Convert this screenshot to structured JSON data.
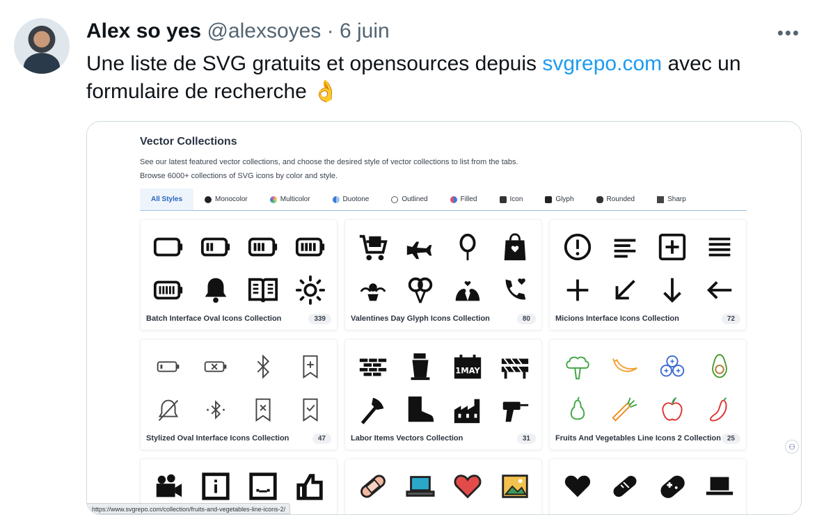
{
  "tweet": {
    "author_name": "Alex so yes",
    "handle": "@alexsoyes",
    "separator": "·",
    "date": "6 juin",
    "more_label": "•••",
    "text_before": "Une liste de SVG gratuits et opensources depuis ",
    "link_text": "svgrepo.com",
    "text_after": " avec un formulaire de recherche ",
    "emoji": "👌"
  },
  "page": {
    "title": "Vector Collections",
    "desc_line1": "See our latest featured vector collections, and choose the desired style of vector collections to list from the tabs.",
    "desc_line2": "Browse 6000+ collections of SVG icons by color and style."
  },
  "tabs": [
    {
      "label": "All Styles",
      "color": ""
    },
    {
      "label": "Monocolor",
      "color": "#222222"
    },
    {
      "label": "Multicolor",
      "color": "#e86aa0"
    },
    {
      "label": "Duotone",
      "color": "#3b7bd5"
    },
    {
      "label": "Outlined",
      "color": "#777777"
    },
    {
      "label": "Filled",
      "color": "#d94f7a"
    },
    {
      "label": "Icon",
      "color": "#333333"
    },
    {
      "label": "Glyph",
      "color": "#222222"
    },
    {
      "label": "Rounded",
      "color": "#333333"
    },
    {
      "label": "Sharp",
      "color": "#444444"
    }
  ],
  "collections": [
    {
      "name": "Batch Interface Oval Icons Collection",
      "count": "339"
    },
    {
      "name": "Valentines Day Glyph Icons Collection",
      "count": "80"
    },
    {
      "name": "Micions Interface Icons Collection",
      "count": "72"
    },
    {
      "name": "Stylized Oval Interface Icons Collection",
      "count": "47"
    },
    {
      "name": "Labor Items Vectors Collection",
      "count": "31"
    },
    {
      "name": "Fruits And Vegetables Line Icons 2 Collection",
      "count": "25"
    }
  ],
  "status_url": "https://www.svgrepo.com/collection/fruits-and-vegetables-line-icons-2/",
  "colors": {
    "link": "#1d9bf0",
    "active_tab": "#2865c2",
    "muted": "#536471"
  },
  "icons": [
    "battery-empty-icon",
    "battery-low-icon",
    "battery-mid-icon",
    "battery-high-icon",
    "battery-full-icon",
    "bell-icon",
    "book-open-icon",
    "sun-icon",
    "shopping-cart-icon",
    "airplane-icon",
    "balloon-icon",
    "gift-bag-icon",
    "cupid-icon",
    "balloons-icon",
    "lovebirds-icon",
    "phone-heart-icon",
    "exclamation-icon",
    "align-left-icon",
    "plus-square-icon",
    "menu-icon",
    "plus-icon",
    "arrow-down-left-icon",
    "arrow-down-icon",
    "arrow-left-icon"
  ]
}
